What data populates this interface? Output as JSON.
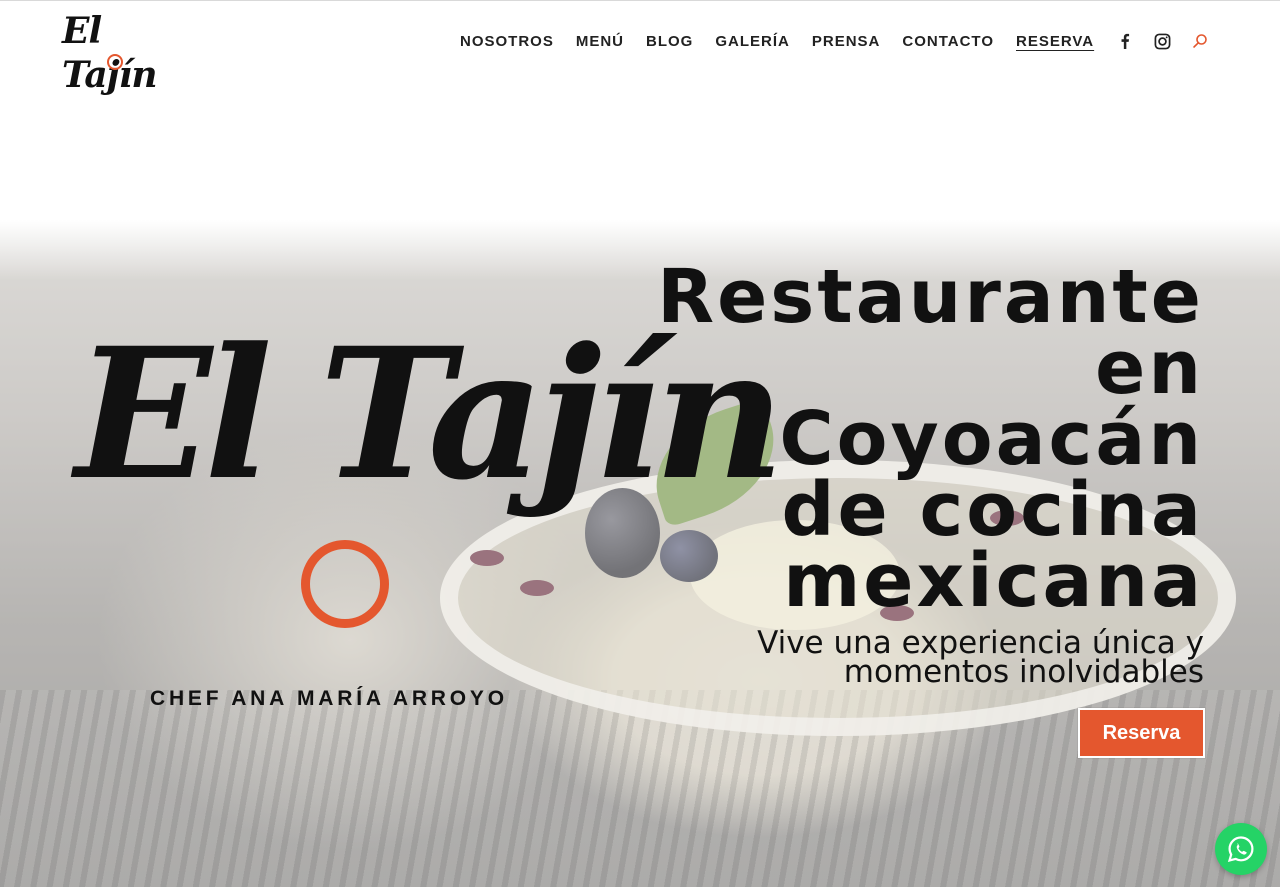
{
  "brand": {
    "logo_text": "El Tajín",
    "accent_color": "#e4572e"
  },
  "nav": {
    "items": [
      {
        "label": "NOSOTROS"
      },
      {
        "label": "MENÚ"
      },
      {
        "label": "BLOG"
      },
      {
        "label": "GALERÍA"
      },
      {
        "label": "PRENSA"
      },
      {
        "label": "CONTACTO"
      },
      {
        "label": "RESERVA",
        "active": true
      }
    ]
  },
  "social": {
    "icons": [
      "facebook-icon",
      "instagram-icon",
      "search-icon"
    ]
  },
  "hero": {
    "logo_text": "El Tajín",
    "chef_text": "CHEF ANA MARÍA ARROYO",
    "title_lines": [
      "Restaurante",
      "en",
      "Coyoacán",
      "de cocina",
      "mexicana"
    ],
    "subtitle_lines": [
      "Vive una experiencia única y",
      "momentos inolvidables"
    ],
    "cta_label": "Reserva"
  },
  "floating": {
    "whatsapp_icon": "whatsapp-icon",
    "whatsapp_color": "#25d366"
  }
}
